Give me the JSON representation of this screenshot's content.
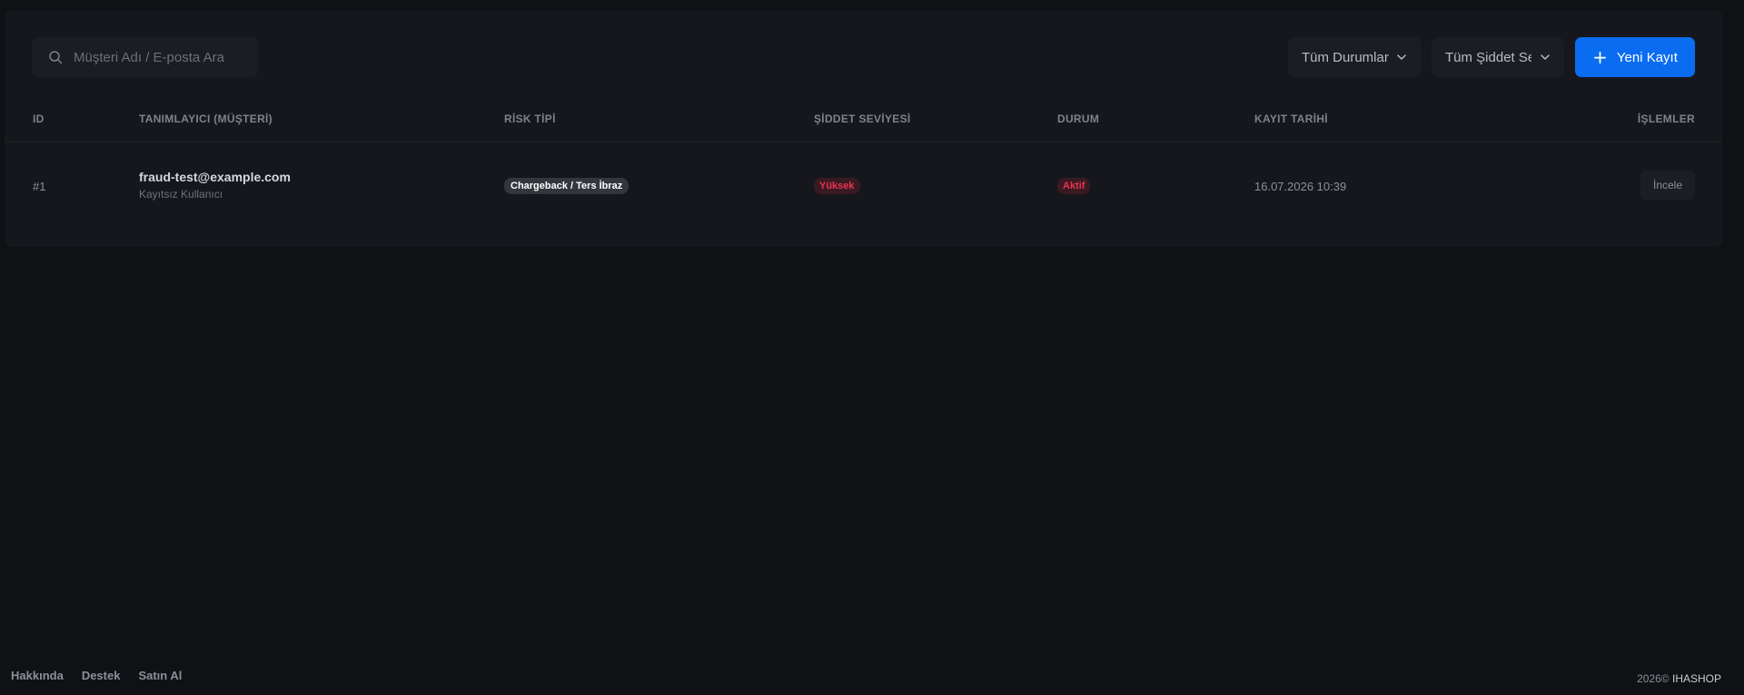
{
  "search": {
    "placeholder": "Müşteri Adı / E-posta Ara"
  },
  "filters": {
    "status_label": "Tüm Durumlar",
    "severity_label": "Tüm Şiddet Seviyeleri"
  },
  "new_button": {
    "label": "Yeni Kayıt",
    "color": "#0a6cf0"
  },
  "table": {
    "headers": [
      "ID",
      "TANIMLAYICI (MÜŞTERİ)",
      "RİSK TİPİ",
      "ŞİDDET SEVİYESİ",
      "DURUM",
      "KAYIT TARİHİ",
      "İŞLEMLER"
    ],
    "rows": [
      {
        "id": "#1",
        "email": "fraud-test@example.com",
        "user_type": "Kayıtsız Kullanıcı",
        "risk_type": "Chargeback / Ters İbraz",
        "severity": "Yüksek",
        "status": "Aktif",
        "date": "16.07.2026 10:39",
        "action": "İncele"
      }
    ]
  },
  "footer": {
    "links": [
      "Hakkında",
      "Destek",
      "Satın Al"
    ],
    "copyright_prefix": "2026©",
    "brand": "IHASHOP"
  }
}
